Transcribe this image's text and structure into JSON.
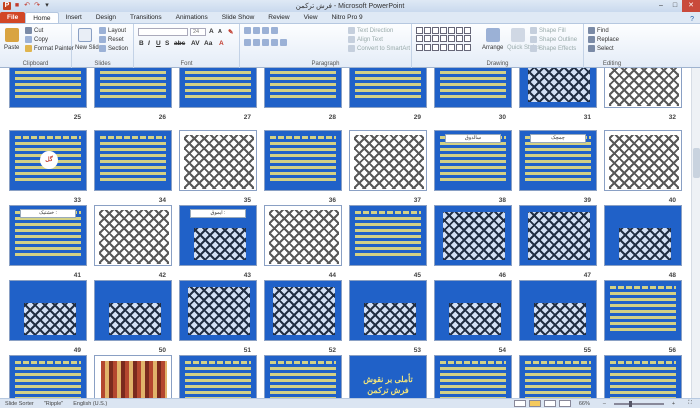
{
  "window": {
    "title": "فرش ترکمن - Microsoft PowerPoint"
  },
  "tabs": [
    "File",
    "Home",
    "Insert",
    "Design",
    "Transitions",
    "Animations",
    "Slide Show",
    "Review",
    "View",
    "Nitro Pro 9"
  ],
  "active_tab": "Home",
  "ribbon": {
    "clipboard": {
      "label": "Clipboard",
      "paste": "Paste",
      "cut": "Cut",
      "copy": "Copy",
      "format_painter": "Format Painter"
    },
    "slides": {
      "label": "Slides",
      "new_slide": "New Slide",
      "layout": "Layout",
      "reset": "Reset",
      "section": "Section"
    },
    "font": {
      "label": "Font",
      "size": "24"
    },
    "paragraph": {
      "label": "Paragraph",
      "text_direction": "Text Direction",
      "align_text": "Align Text",
      "convert_smartart": "Convert to SmartArt"
    },
    "drawing": {
      "label": "Drawing",
      "arrange": "Arrange",
      "quick_styles": "Quick Styles",
      "shape_fill": "Shape Fill",
      "shape_outline": "Shape Outline",
      "shape_effects": "Shape Effects"
    },
    "editing": {
      "label": "Editing",
      "find": "Find",
      "replace": "Replace",
      "select": "Select"
    }
  },
  "slide_numbers": {
    "row1": [
      "25",
      "26",
      "27",
      "28",
      "29",
      "30",
      "31",
      "32"
    ],
    "row2": [
      "33",
      "34",
      "35",
      "36",
      "37",
      "38",
      "39",
      "40"
    ],
    "row3": [
      "41",
      "42",
      "43",
      "44",
      "45",
      "46",
      "47",
      "48"
    ],
    "row4": [
      "49",
      "50",
      "51",
      "52",
      "53",
      "54",
      "55",
      "56"
    ]
  },
  "slide_texts": {
    "title_slide": "تأملی بر نقوش\nفرش ترکمن",
    "header_34": "گل",
    "header_38": "سالدوق",
    "header_39": "چمچک",
    "header_41": "خشتیک :",
    "header_43": "ایموق :"
  },
  "status": {
    "view": "Slide Sorter",
    "theme": "\"Ripple\"",
    "language": "English (U.S.)",
    "zoom": "66%"
  }
}
